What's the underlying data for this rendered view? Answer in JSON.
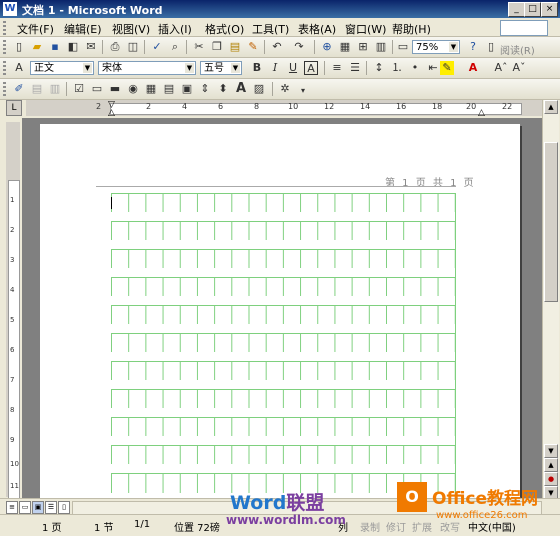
{
  "window": {
    "title": "文档 1 - Microsoft Word",
    "app_icon": "W"
  },
  "menu": [
    {
      "label": "文件(F)"
    },
    {
      "label": "编辑(E)"
    },
    {
      "label": "视图(V)"
    },
    {
      "label": "插入(I)"
    },
    {
      "label": "格式(O)"
    },
    {
      "label": "工具(T)"
    },
    {
      "label": "表格(A)"
    },
    {
      "label": "窗口(W)"
    },
    {
      "label": "帮助(H)"
    }
  ],
  "standard_toolbar": {
    "zoom": "75%",
    "read_label": "阅读(R)"
  },
  "format_toolbar": {
    "style": "正文",
    "font": "宋体",
    "size": "五号",
    "bold": "B",
    "italic": "I",
    "underline": "U"
  },
  "ruler": {
    "tab_marker": "L",
    "h_numbers": [
      "2",
      "2",
      "4",
      "6",
      "8",
      "10",
      "12",
      "14",
      "16",
      "18",
      "20",
      "22"
    ]
  },
  "vruler": {
    "numbers": [
      "1",
      "2",
      "3",
      "4",
      "5",
      "6",
      "7",
      "8",
      "9",
      "10",
      "11"
    ]
  },
  "document": {
    "page_label": "第 1 页 共 1 页"
  },
  "status": {
    "page": "1 页",
    "section": "1 节",
    "position": "1/1",
    "location": "位置 72磅",
    "col": "列",
    "rec": "录制",
    "rev": "修订",
    "ext": "扩展",
    "ovr": "改写",
    "lang": "中文(中国)"
  },
  "watermarks": {
    "brand1_a": "Word",
    "brand1_b": "联盟",
    "brand1_url": "www.wordlm.com",
    "brand2_logo": "O",
    "brand2": "Office教程网",
    "brand2_url": "www.office26.com"
  },
  "colors": {
    "title_bar": "#0a246a",
    "grid_line": "#7ed07e",
    "wm_blue": "#2277cc",
    "wm_orange": "#f07a00"
  }
}
